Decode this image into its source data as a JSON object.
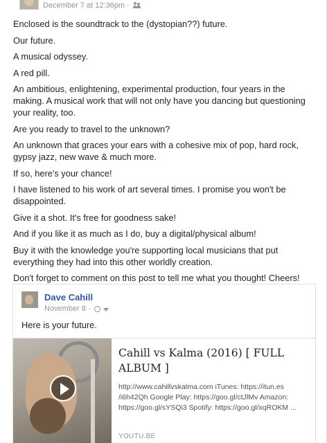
{
  "post": {
    "timestamp": "December 7 at 12:36pm",
    "separator": "·",
    "paragraphs": [
      "Enclosed is the soundtrack to the (dystopian??) future.",
      "Our future.",
      "A musical odyssey.",
      "A red pill.",
      "An ambitious, enlightening, experimental production, four years in the making. A musical work that will not only have you dancing but questioning your reality, too.",
      "Are you ready to travel to the unknown?",
      "An unknown that graces your ears with a cohesive mix of pop, hard rock, gypsy jazz, new wave & much more.",
      "If so, here's your chance!",
      "I have listened to his work of art several times. I promise you won't be disappointed.",
      "Give it a shot. It's free for goodness sake!",
      "And if you like it as much as I do, buy a digital/physical album!",
      "Buy it with the knowledge you're supporting local musicians that put everything they had into this other worldly creation.",
      "Don't forget to comment on this post to tell me what you thought! Cheers!"
    ]
  },
  "shared": {
    "author": "Dave Cahill",
    "date": "November 8",
    "separator": "·",
    "text": "Here is your future.",
    "link": {
      "title": "Cahill vs Kalma (2016) [ FULL ALBUM ]",
      "description": "http://www.cahillvskalma.com iTunes: https://itun.es /i6h42Qh Google Play: https://goo.gl/ctJlMv Amazon: https://goo.gl/sYSQi3 Spotify: https://goo.gl/xqROKM ...",
      "domain": "YOUTU.BE"
    }
  }
}
